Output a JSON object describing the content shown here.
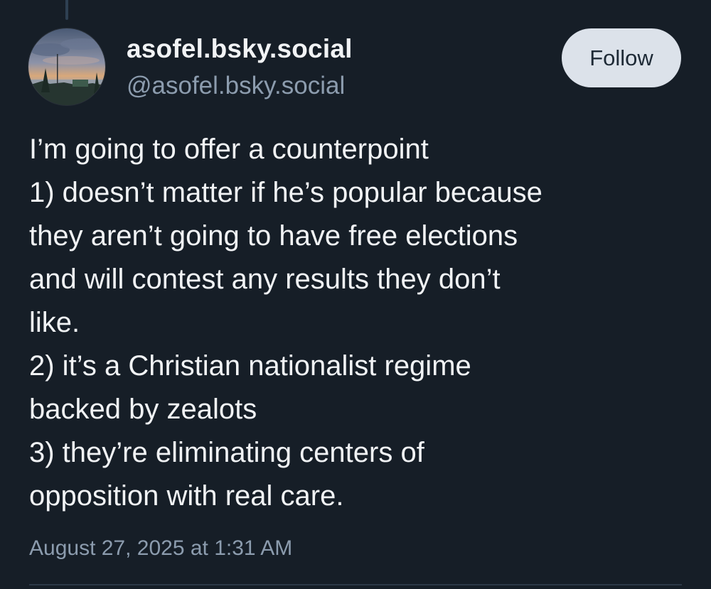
{
  "post": {
    "author": {
      "display_name": "asofel.bsky.social",
      "handle": "@asofel.bsky.social"
    },
    "follow_label": "Follow",
    "lines": [
      "I’m going to offer a counterpoint",
      "1) doesn’t matter if he’s popular because",
      "they aren’t going to have free elections",
      "and will contest any results they don’t",
      "like.",
      "2) it’s a Christian nationalist regime",
      "backed by zealots",
      "3) they’re eliminating centers of",
      "opposition with real care."
    ],
    "timestamp": "August 27, 2025 at 1:31 AM"
  },
  "colors": {
    "background": "#161e27",
    "text_primary": "#f1f3f5",
    "text_secondary": "#8c9cae",
    "button_bg": "#dce2ea",
    "button_text": "#1e2a36"
  }
}
